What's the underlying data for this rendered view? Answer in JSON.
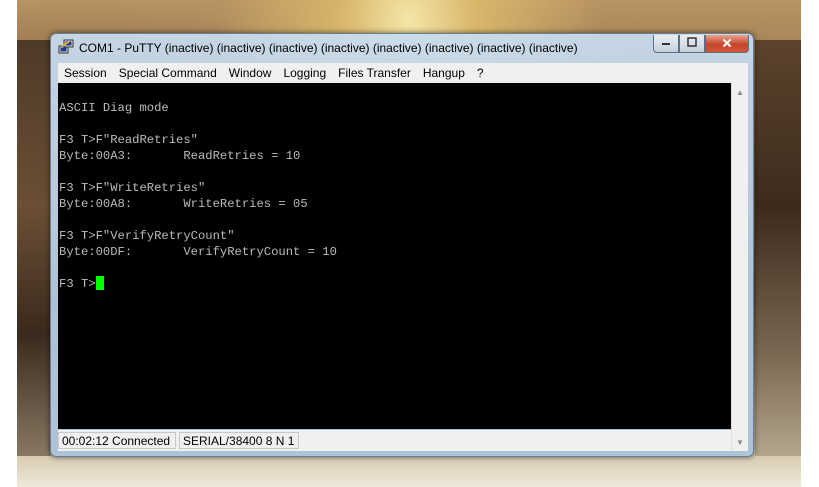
{
  "window": {
    "title": "COM1 - PuTTY (inactive) (inactive) (inactive) (inactive) (inactive) (inactive) (inactive) (inactive)",
    "icon": "putty-icon",
    "controls": {
      "minimize": "minimize-icon",
      "maximize": "maximize-icon",
      "close": "close-icon"
    }
  },
  "menu": {
    "items": [
      "Session",
      "Special Command",
      "Window",
      "Logging",
      "Files Transfer",
      "Hangup",
      "?"
    ]
  },
  "terminal": {
    "background": "#000000",
    "text_color": "#bbbbbb",
    "cursor_color": "#00ff00",
    "lines": [
      "ASCII Diag mode",
      "",
      "F3 T>F\"ReadRetries\"",
      "Byte:00A3:       ReadRetries = 10",
      "",
      "F3 T>F\"WriteRetries\"",
      "Byte:00A8:       WriteRetries = 05",
      "",
      "F3 T>F\"VerifyRetryCount\"",
      "Byte:00DF:       VerifyRetryCount = 10",
      "",
      "F3 T>"
    ]
  },
  "statusbar": {
    "elapsed": "00:02:12 Connected",
    "serial": "SERIAL/38400 8 N 1"
  }
}
